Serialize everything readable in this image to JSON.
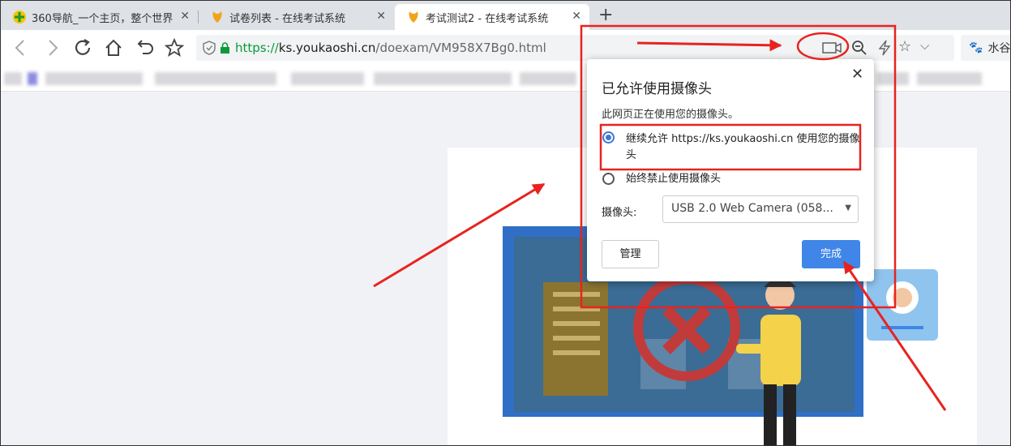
{
  "tabs": [
    {
      "title": "360导航_一个主页，整个世界",
      "close": "✕"
    },
    {
      "title": "试卷列表 - 在线考试系统",
      "close": "✕"
    },
    {
      "title": "考试测试2 - 在线考试系统",
      "close": "✕"
    }
  ],
  "new_tab": "+",
  "toolbar": {
    "url_scheme": "https://",
    "url_host": "ks.youkaoshi.cn",
    "url_path": "/doexam/VM958X7Bg0.html",
    "right_chip": "水谷"
  },
  "popup": {
    "title": "已允许使用摄像头",
    "close": "✕",
    "description": "此网页正在使用您的摄像头。",
    "option_allow": "继续允许 https://ks.youkaoshi.cn 使用您的摄像头",
    "option_block": "始终禁止使用摄像头",
    "camera_label": "摄像头:",
    "camera_value": "USB 2.0 Web Camera (058...",
    "manage_button": "管理",
    "done_button": "完成"
  },
  "colors": {
    "annotation_red": "#e8231f",
    "accent_blue": "#3f86e8",
    "url_green": "#0a9a3a"
  },
  "icons": [
    "back-icon",
    "forward-icon",
    "reload-icon",
    "home-icon",
    "undo-icon",
    "star-icon",
    "shield-icon",
    "lock-icon",
    "camera-icon",
    "zoom-icon",
    "bolt-icon",
    "paw-icon"
  ]
}
